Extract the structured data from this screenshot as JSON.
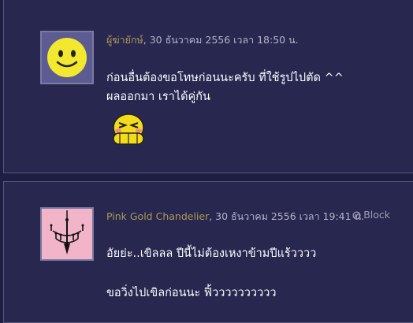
{
  "comments": [
    {
      "author": "ผู้ฆ่ายักษ์",
      "timestamp": ", 30 ธันวาคม 2556 เวลา 18:50 น.",
      "lines": [
        "ก่อนอื่นต้องขอโทษก่อนนะครับ ที่ใช้รูปไปตัด ^^",
        "ผลออกมา เราได้คู่กัน"
      ],
      "avatar_icon": "smiley-face-icon",
      "emoticon": "laughing-emoticon-icon"
    },
    {
      "author": "Pink Gold Chandelier",
      "timestamp": ", 30 ธันวาคม 2556 เวลา 19:41 น.",
      "block_label": "Block",
      "lines": [
        "อัยย่ะ..เขิลลล ปีนี้ไม่ต้องเหงาข้ามปีแร้วววว",
        "ขอวิ่งไปเขิลก่อนนะ ฟิ้วววววววววว"
      ],
      "avatar_icon": "chandelier-icon"
    }
  ],
  "colors": {
    "background": "#1e1d42",
    "card": "#282750",
    "author": "#a99a52",
    "text": "#ffffff"
  }
}
